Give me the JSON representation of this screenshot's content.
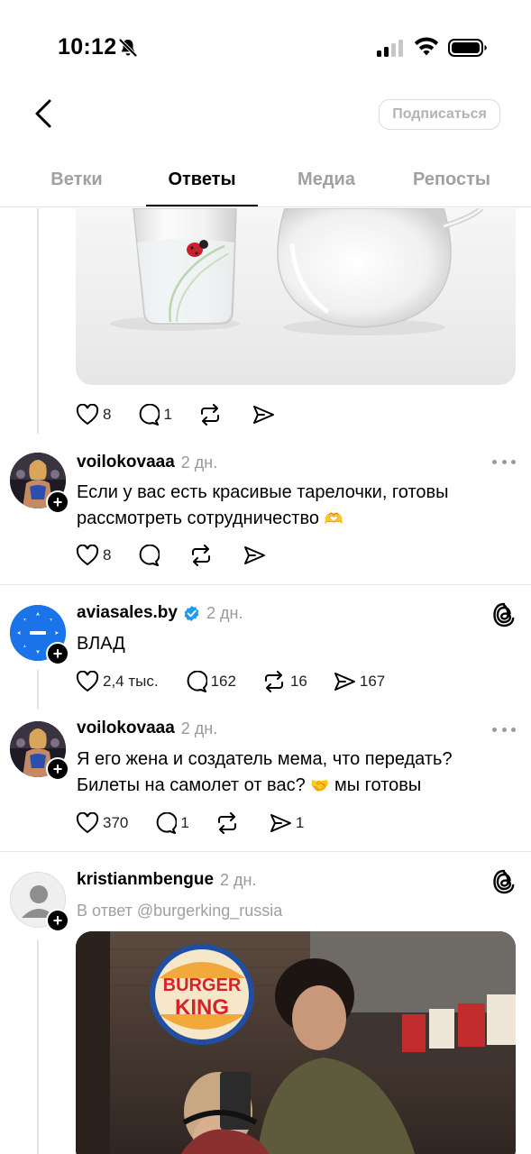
{
  "status_bar": {
    "time": "10:12"
  },
  "header": {
    "subscribe_label": "Подписаться"
  },
  "tabs": [
    {
      "label": "Ветки"
    },
    {
      "label": "Ответы"
    },
    {
      "label": "Медиа"
    },
    {
      "label": "Репосты"
    }
  ],
  "active_tab": "Ответы",
  "posts": [
    {
      "kind": "media-tail",
      "actions": {
        "likes": "8",
        "comments": "1",
        "reposts": "",
        "shares": ""
      }
    },
    {
      "username": "voilokovaaa",
      "time": "2 дн.",
      "text_line1": "Если у вас есть красивые тарелочки, готовы",
      "text_line2": "рассмотреть сотрудничество",
      "emoji": "🫶",
      "actions": {
        "likes": "8",
        "comments": "",
        "reposts": "",
        "shares": ""
      }
    },
    {
      "username": "aviasales.by",
      "time": "2 дн.",
      "verified": true,
      "text": "ВЛАД",
      "actions": {
        "likes": "2,4 тыс.",
        "comments": "162",
        "reposts": "16",
        "shares": "167"
      }
    },
    {
      "username": "voilokovaaa",
      "time": "2 дн.",
      "text_line1": "Я его жена и создатель мема, что передать?",
      "text_line2_a": "Билеты на самолет от вас?",
      "emoji": "🤝",
      "text_line2_b": "мы готовы",
      "actions": {
        "likes": "370",
        "comments": "1",
        "reposts": "",
        "shares": "1"
      }
    },
    {
      "username": "kristianmbengue",
      "time": "2 дн.",
      "reply_to": "В ответ @burgerking_russia",
      "photo_logo_top": "BURGER",
      "photo_logo_bottom": "KING"
    }
  ],
  "colors": {
    "text": "#000000",
    "muted": "#999999",
    "verified": "#1d9bf0",
    "aviasales_blue": "#1a73e8",
    "divider": "#e8e8e8"
  },
  "icons": {
    "like": "heart-icon",
    "comment": "comment-icon",
    "repost": "repost-icon",
    "share": "share-icon",
    "more": "more-icon",
    "threads": "threads-logo-icon",
    "back": "chevron-left-icon",
    "mute": "bell-slash-icon"
  }
}
